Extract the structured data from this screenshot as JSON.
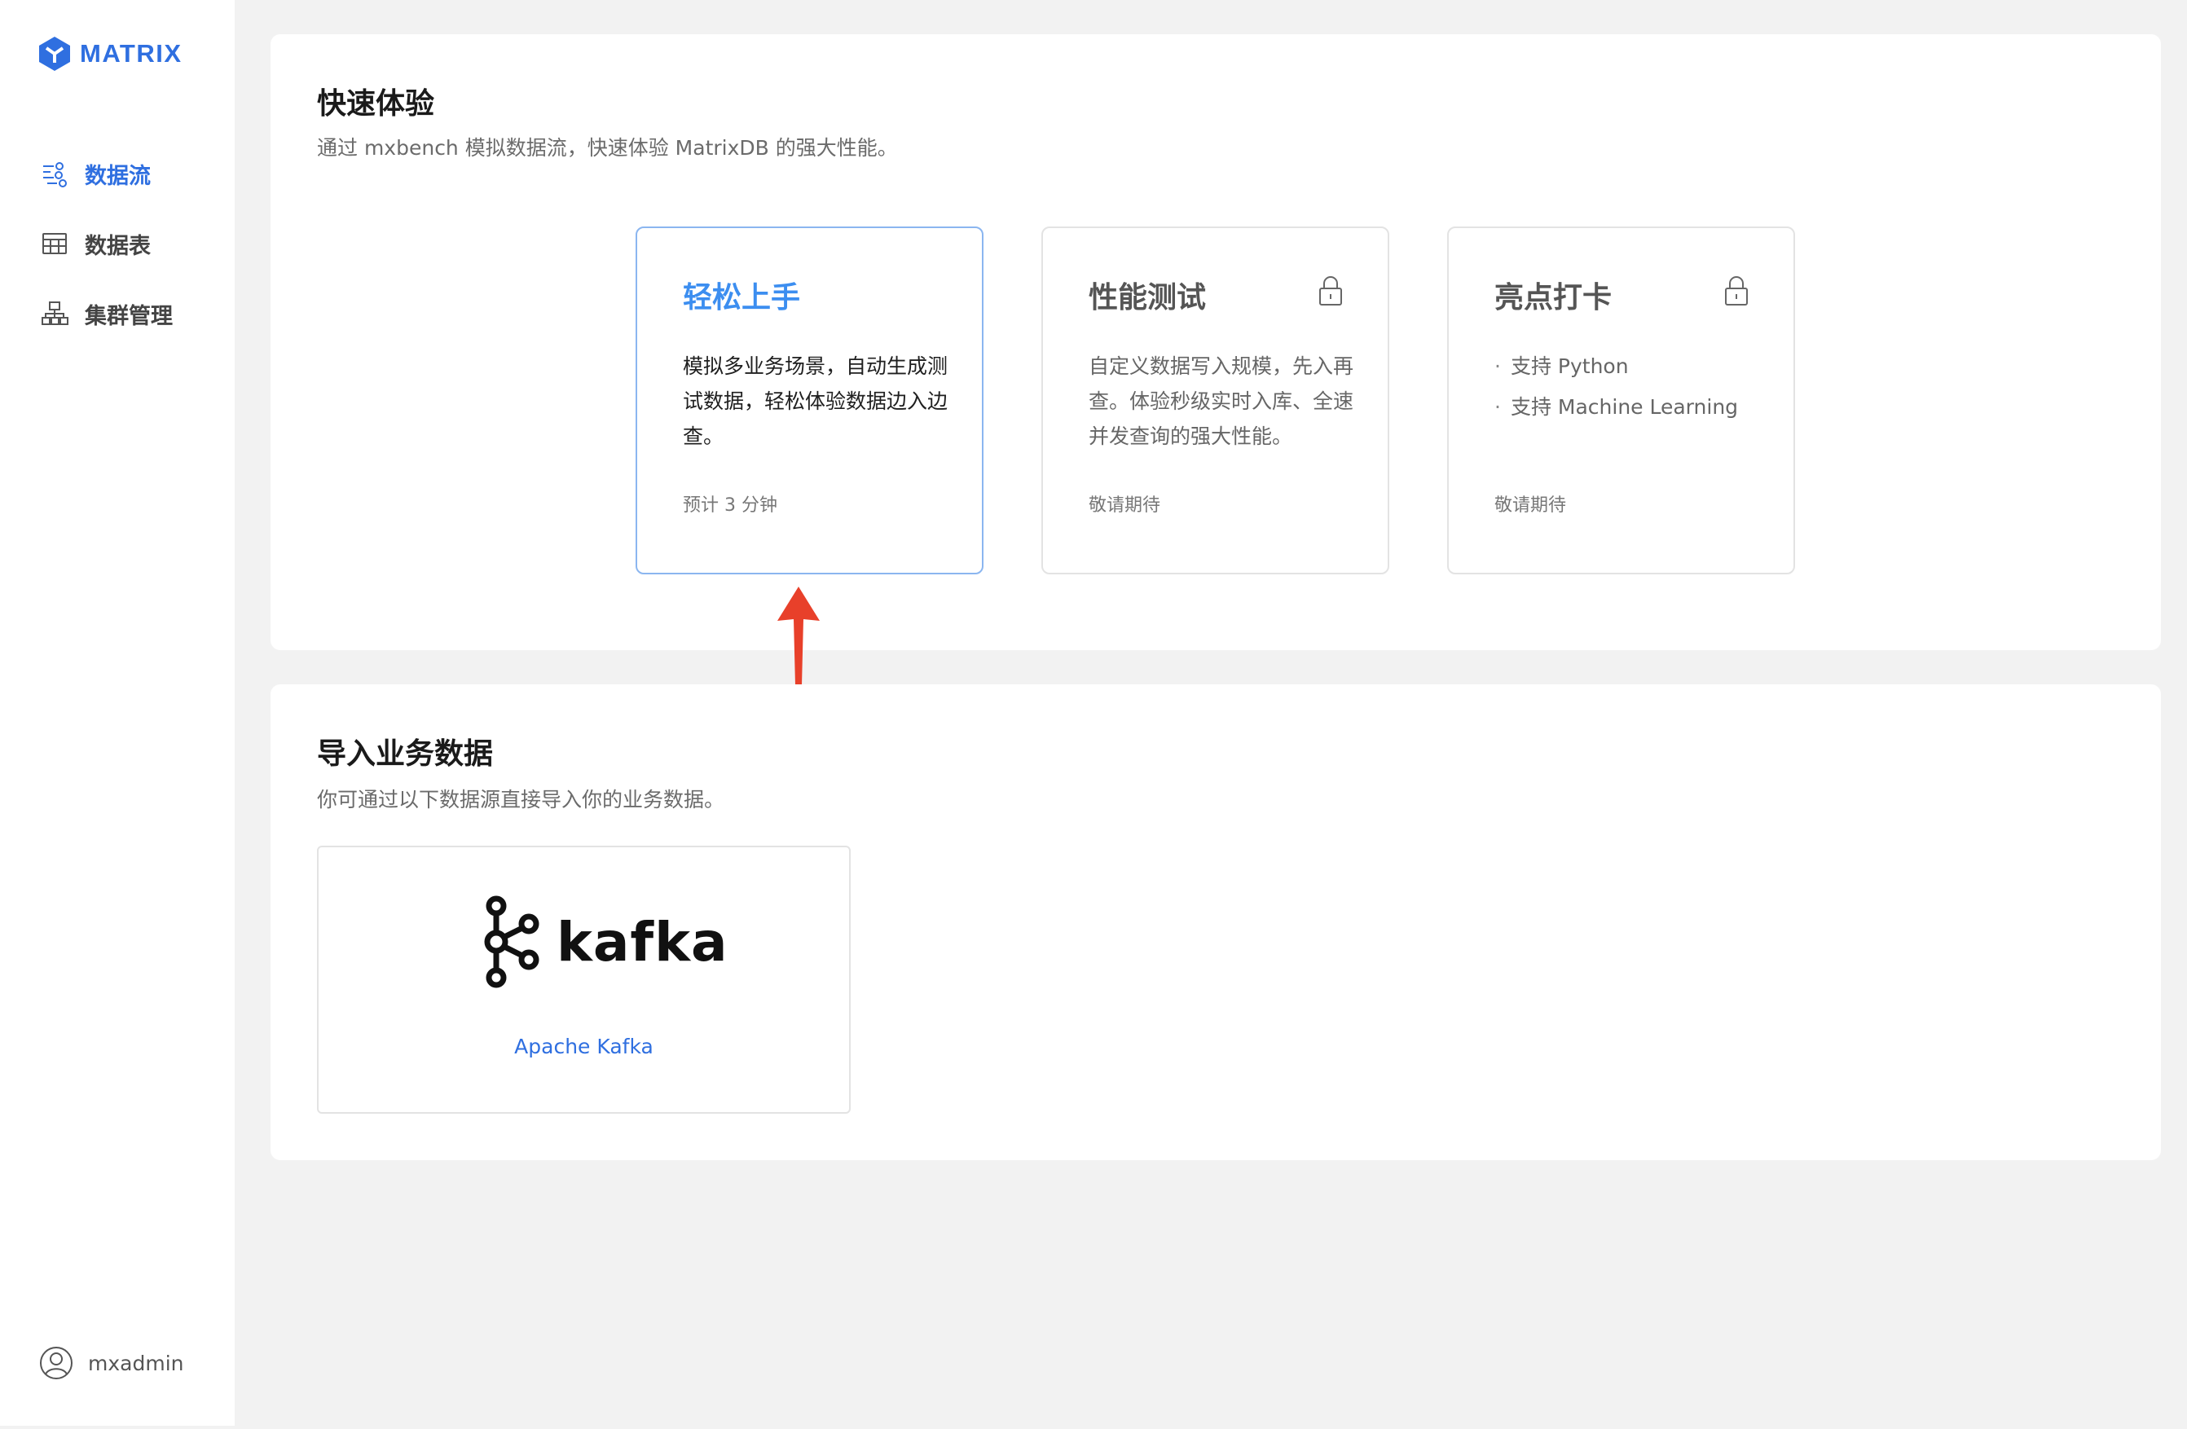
{
  "brand": {
    "name": "MATRIX",
    "color": "#2f6fe0"
  },
  "sidebar": {
    "items": [
      {
        "label": "数据流",
        "icon": "data-flow-icon",
        "active": true
      },
      {
        "label": "数据表",
        "icon": "table-icon",
        "active": false
      },
      {
        "label": "集群管理",
        "icon": "cluster-icon",
        "active": false
      }
    ],
    "user": {
      "name": "mxadmin",
      "icon": "user-avatar-icon"
    }
  },
  "quick": {
    "title": "快速体验",
    "desc": "通过 mxbench 模拟数据流，快速体验 MatrixDB 的强大性能。",
    "cards": [
      {
        "title": "轻松上手",
        "body": "模拟多业务场景，自动生成测试数据，轻松体验数据边入边查。",
        "foot": "预计 3 分钟",
        "locked": false
      },
      {
        "title": "性能测试",
        "body": "自定义数据写入规模，先入再查。体验秒级实时入库、全速并发查询的强大性能。",
        "foot": "敬请期待",
        "locked": true
      },
      {
        "title": "亮点打卡",
        "bullets": [
          "支持 Python",
          "支持 Machine Learning"
        ],
        "foot": "敬请期待",
        "locked": true
      }
    ]
  },
  "import": {
    "title": "导入业务数据",
    "desc": "你可通过以下数据源直接导入你的业务数据。",
    "sources": [
      {
        "logo_text": "kafka",
        "label": "Apache Kafka",
        "icon": "kafka-logo-icon"
      }
    ]
  },
  "colors": {
    "accent": "#3c8ef0",
    "link": "#2f6fe0",
    "annotation_arrow": "#e8402a"
  }
}
